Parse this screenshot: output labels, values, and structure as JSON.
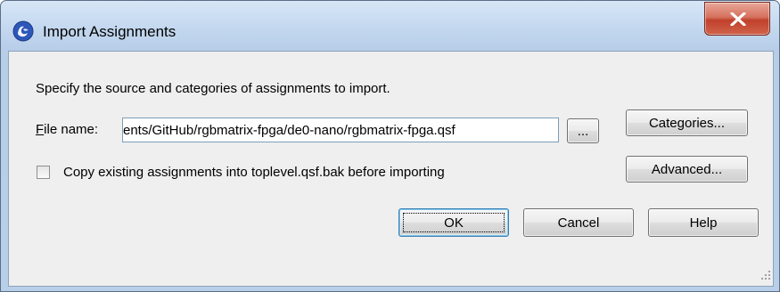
{
  "window": {
    "title": "Import Assignments",
    "icon": "quartus-app-icon",
    "close_glyph": "x"
  },
  "dialog": {
    "instruction": "Specify the source and categories of assignments to import.",
    "file_label_mnemonic": "F",
    "file_label_rest": "ile name:",
    "file_name_value": "ents/GitHub/rgbmatrix-fpga/de0-nano/rgbmatrix-fpga.qsf",
    "browse_label": "...",
    "categories_label": "Categories...",
    "advanced_label": "Advanced...",
    "copy_checkbox_label": "Copy existing assignments into toplevel.qsf.bak before importing",
    "copy_checkbox_checked": false,
    "ok_label": "OK",
    "cancel_label": "Cancel",
    "help_label": "Help"
  },
  "colors": {
    "titlebar": "#c4d8ef",
    "client_bg": "#efefef",
    "close_button": "#c0402a",
    "default_button_border": "#3c7fb1"
  }
}
